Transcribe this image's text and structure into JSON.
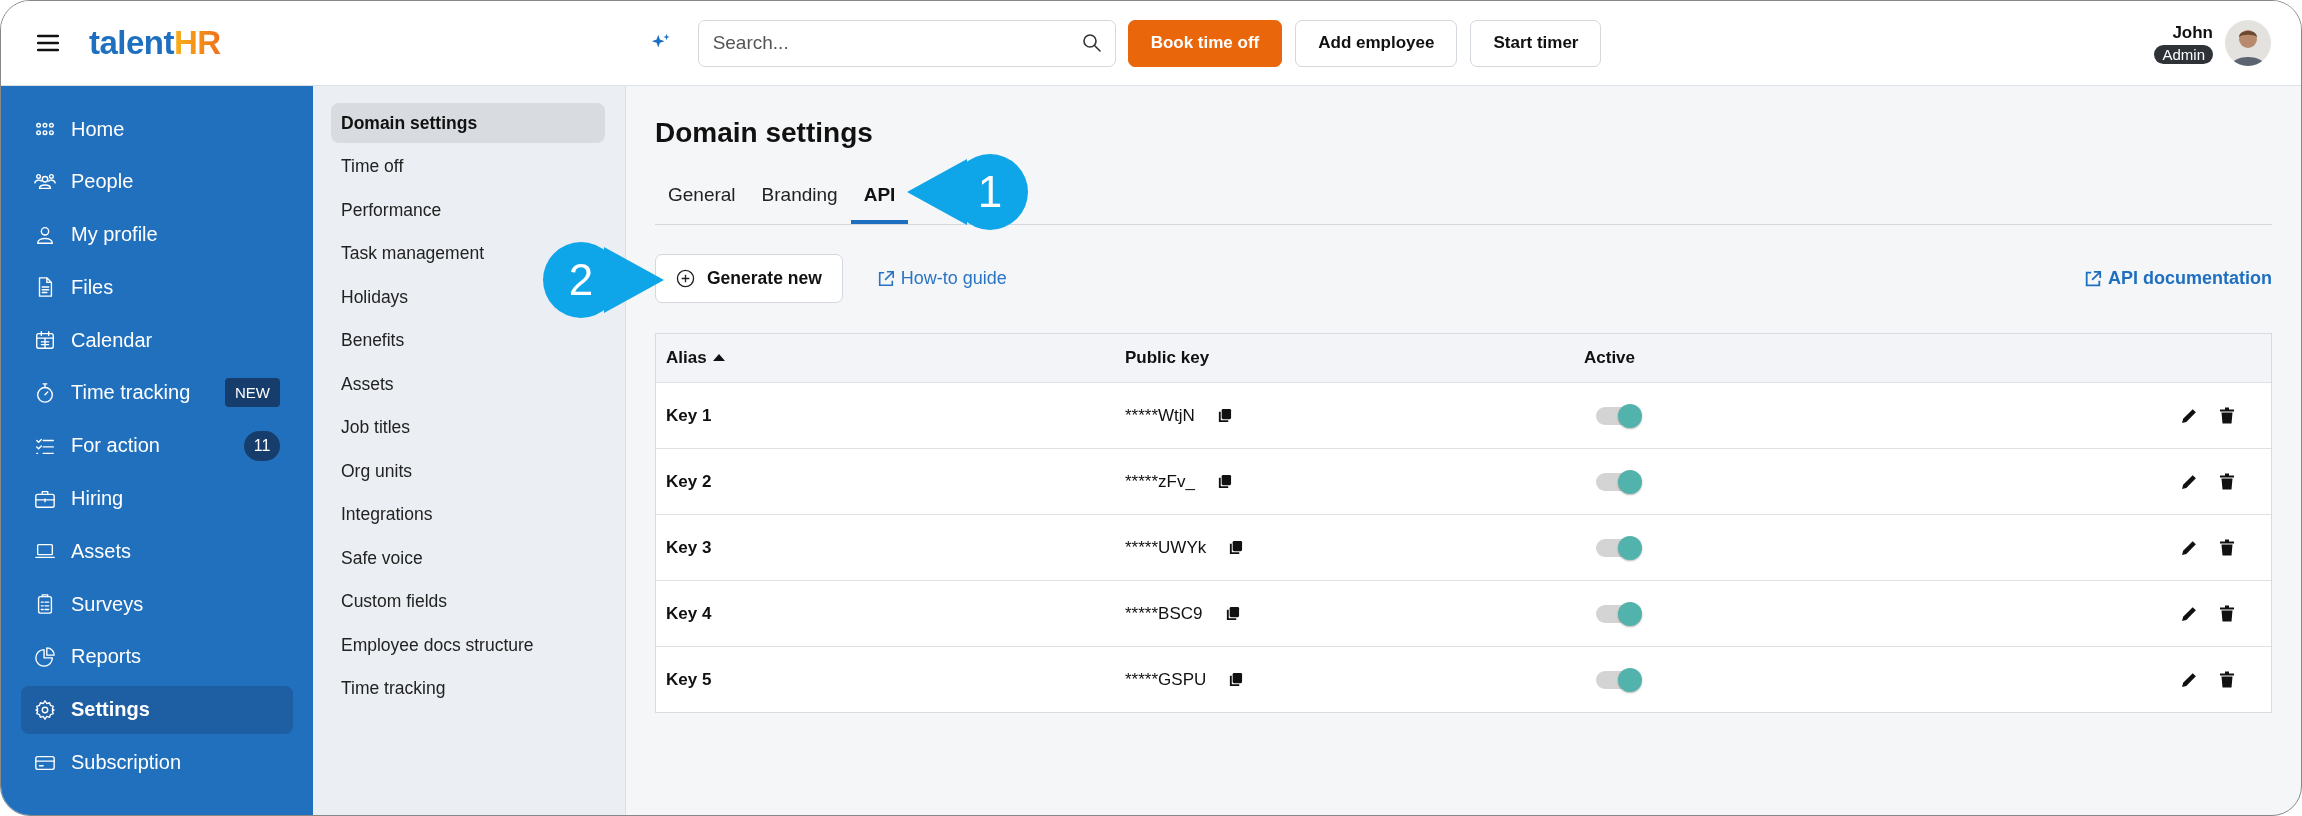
{
  "header": {
    "logo": {
      "text": "talent",
      "accent": "HR"
    },
    "search": {
      "placeholder": "Search..."
    },
    "buttons": [
      {
        "label": "Book time off",
        "kind": "primary"
      },
      {
        "label": "Add employee",
        "kind": "secondary"
      },
      {
        "label": "Start timer",
        "kind": "secondary"
      }
    ],
    "user": {
      "name": "John",
      "role": "Admin"
    }
  },
  "sidebar": {
    "items": [
      {
        "label": "Home",
        "selected": false
      },
      {
        "label": "People",
        "selected": false
      },
      {
        "label": "My profile",
        "selected": false
      },
      {
        "label": "Files",
        "selected": false
      },
      {
        "label": "Calendar",
        "selected": false
      },
      {
        "label": "Time tracking",
        "selected": false,
        "badge": {
          "text": "NEW",
          "kind": "tag"
        }
      },
      {
        "label": "For action",
        "selected": false,
        "badge": {
          "text": "11",
          "kind": "count"
        }
      },
      {
        "label": "Hiring",
        "selected": false
      },
      {
        "label": "Assets",
        "selected": false
      },
      {
        "label": "Surveys",
        "selected": false
      },
      {
        "label": "Reports",
        "selected": false
      },
      {
        "label": "Settings",
        "selected": true
      },
      {
        "label": "Subscription",
        "selected": false
      }
    ]
  },
  "settings_nav": {
    "items": [
      {
        "label": "Domain settings",
        "selected": true
      },
      {
        "label": "Time off",
        "selected": false
      },
      {
        "label": "Performance",
        "selected": false
      },
      {
        "label": "Task management",
        "selected": false
      },
      {
        "label": "Holidays",
        "selected": false
      },
      {
        "label": "Benefits",
        "selected": false
      },
      {
        "label": "Assets",
        "selected": false
      },
      {
        "label": "Job titles",
        "selected": false
      },
      {
        "label": "Org units",
        "selected": false
      },
      {
        "label": "Integrations",
        "selected": false
      },
      {
        "label": "Safe voice",
        "selected": false
      },
      {
        "label": "Custom fields",
        "selected": false
      },
      {
        "label": "Employee docs structure",
        "selected": false
      },
      {
        "label": "Time tracking",
        "selected": false
      }
    ]
  },
  "main": {
    "title": "Domain settings",
    "tabs": [
      {
        "label": "General",
        "selected": false
      },
      {
        "label": "Branding",
        "selected": false
      },
      {
        "label": "API",
        "selected": true
      }
    ],
    "generate_button": "Generate new",
    "howto_link": "How-to guide",
    "docs_link": "API documentation",
    "table": {
      "columns": [
        {
          "label": "Alias",
          "sorted": true
        },
        {
          "label": "Public key",
          "sorted": false
        },
        {
          "label": "Active",
          "sorted": false
        }
      ],
      "rows": [
        {
          "alias": "Key 1",
          "public_key": "*****WtjN",
          "active": true
        },
        {
          "alias": "Key 2",
          "public_key": "*****zFv_",
          "active": true
        },
        {
          "alias": "Key 3",
          "public_key": "*****UWYk",
          "active": true
        },
        {
          "alias": "Key 4",
          "public_key": "*****BSC9",
          "active": true
        },
        {
          "alias": "Key 5",
          "public_key": "*****GSPU",
          "active": true
        }
      ]
    }
  },
  "callouts": [
    {
      "number": "1"
    },
    {
      "number": "2"
    }
  ]
}
